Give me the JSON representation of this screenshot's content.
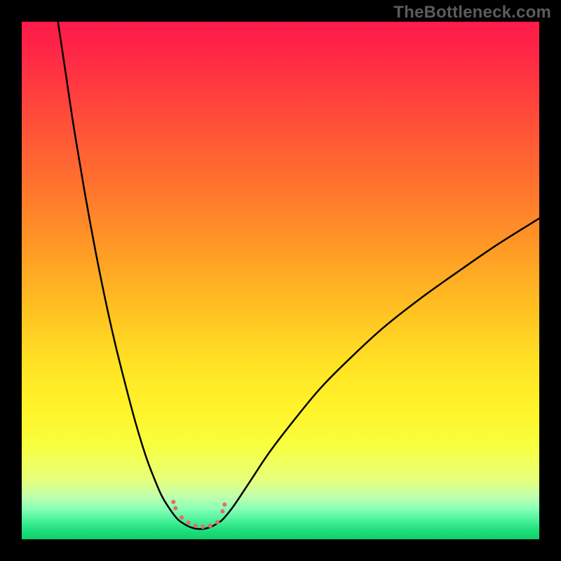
{
  "watermark": "TheBottleneck.com",
  "chart_data": {
    "type": "line",
    "title": "",
    "xlabel": "",
    "ylabel": "",
    "xlim": [
      0,
      100
    ],
    "ylim": [
      0,
      100
    ],
    "grid": false,
    "background_gradient": {
      "stops": [
        {
          "offset": 0.0,
          "color": "#ff1a4b"
        },
        {
          "offset": 0.07,
          "color": "#ff2a45"
        },
        {
          "offset": 0.18,
          "color": "#ff4b3a"
        },
        {
          "offset": 0.3,
          "color": "#ff6e2f"
        },
        {
          "offset": 0.42,
          "color": "#ff9426"
        },
        {
          "offset": 0.55,
          "color": "#ffbf22"
        },
        {
          "offset": 0.66,
          "color": "#ffe224"
        },
        {
          "offset": 0.75,
          "color": "#fff42a"
        },
        {
          "offset": 0.82,
          "color": "#f8ff40"
        },
        {
          "offset": 0.885,
          "color": "#e7ff7a"
        },
        {
          "offset": 0.918,
          "color": "#bfffad"
        },
        {
          "offset": 0.942,
          "color": "#86ffb6"
        },
        {
          "offset": 0.962,
          "color": "#4cf39a"
        },
        {
          "offset": 0.982,
          "color": "#1fe07e"
        },
        {
          "offset": 1.0,
          "color": "#0fd06c"
        }
      ]
    },
    "series": [
      {
        "name": "left-branch",
        "color": "#000000",
        "width": 2.5,
        "x": [
          7.0,
          8.5,
          10.0,
          12.0,
          14.0,
          16.0,
          18.0,
          20.0,
          22.0,
          24.0,
          25.5,
          27.0,
          28.5,
          30.0
        ],
        "y": [
          100.0,
          90.0,
          80.0,
          68.0,
          57.0,
          47.0,
          38.0,
          30.0,
          22.5,
          16.0,
          12.0,
          8.5,
          6.0,
          4.0
        ]
      },
      {
        "name": "trough",
        "color": "#000000",
        "width": 2.5,
        "x": [
          30.0,
          31.0,
          32.0,
          33.0,
          34.0,
          35.0,
          36.0,
          37.0,
          38.0,
          39.0
        ],
        "y": [
          4.0,
          3.2,
          2.6,
          2.2,
          2.0,
          2.0,
          2.2,
          2.6,
          3.2,
          4.0
        ]
      },
      {
        "name": "right-branch",
        "color": "#000000",
        "width": 2.5,
        "x": [
          39.0,
          41.0,
          44.0,
          48.0,
          53.0,
          58.0,
          64.0,
          70.0,
          77.0,
          84.0,
          92.0,
          100.0
        ],
        "y": [
          4.0,
          6.5,
          11.0,
          17.0,
          23.5,
          29.5,
          35.5,
          41.0,
          46.5,
          51.5,
          57.0,
          62.0
        ]
      }
    ],
    "markers": [
      {
        "name": "trough-dots",
        "color": "#e66a6a",
        "radius": 3.8,
        "points": [
          {
            "x": 29.3,
            "y": 7.2
          },
          {
            "x": 29.7,
            "y": 6.0
          },
          {
            "x": 30.9,
            "y": 4.2
          },
          {
            "x": 32.2,
            "y": 3.2
          },
          {
            "x": 33.6,
            "y": 2.6
          },
          {
            "x": 35.0,
            "y": 2.4
          },
          {
            "x": 36.4,
            "y": 2.6
          },
          {
            "x": 37.8,
            "y": 3.3
          },
          {
            "x": 38.8,
            "y": 5.4
          },
          {
            "x": 39.2,
            "y": 6.7
          }
        ]
      }
    ]
  }
}
